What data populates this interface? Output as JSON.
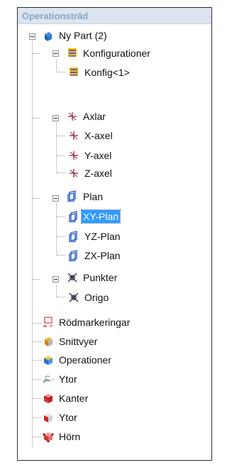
{
  "panel": {
    "title": "Operationsträd"
  },
  "tree": {
    "root": {
      "label": "Ny Part (2)",
      "icon": "part-icon"
    },
    "configurations": {
      "label": "Konfigurationer",
      "icon": "configurations-icon",
      "children": [
        {
          "label": "Konfig<1>",
          "icon": "configuration-icon"
        }
      ]
    },
    "axes": {
      "label": "Axlar",
      "icon": "axes-icon",
      "children": [
        {
          "label": "X-axel",
          "icon": "axis-icon"
        },
        {
          "label": "Y-axel",
          "icon": "axis-icon"
        },
        {
          "label": "Z-axel",
          "icon": "axis-icon"
        }
      ]
    },
    "planes": {
      "label": "Plan",
      "icon": "plane-icon",
      "children": [
        {
          "label": "XY-Plan",
          "icon": "plane-icon",
          "selected": true
        },
        {
          "label": "YZ-Plan",
          "icon": "plane-icon"
        },
        {
          "label": "ZX-Plan",
          "icon": "plane-icon"
        }
      ]
    },
    "points": {
      "label": "Punkter",
      "icon": "points-icon",
      "children": [
        {
          "label": "Origo",
          "icon": "point-icon"
        }
      ]
    },
    "leaves": [
      {
        "label": "Rödmarkeringar",
        "icon": "redline-icon"
      },
      {
        "label": "Snittvyer",
        "icon": "section-view-icon"
      },
      {
        "label": "Operationer",
        "icon": "operations-icon"
      },
      {
        "label": "Ytor",
        "icon": "surfaces-icon"
      },
      {
        "label": "Kanter",
        "icon": "edges-icon"
      },
      {
        "label": "Ytor",
        "icon": "faces-icon"
      },
      {
        "label": "Hörn",
        "icon": "vertices-icon"
      }
    ]
  }
}
